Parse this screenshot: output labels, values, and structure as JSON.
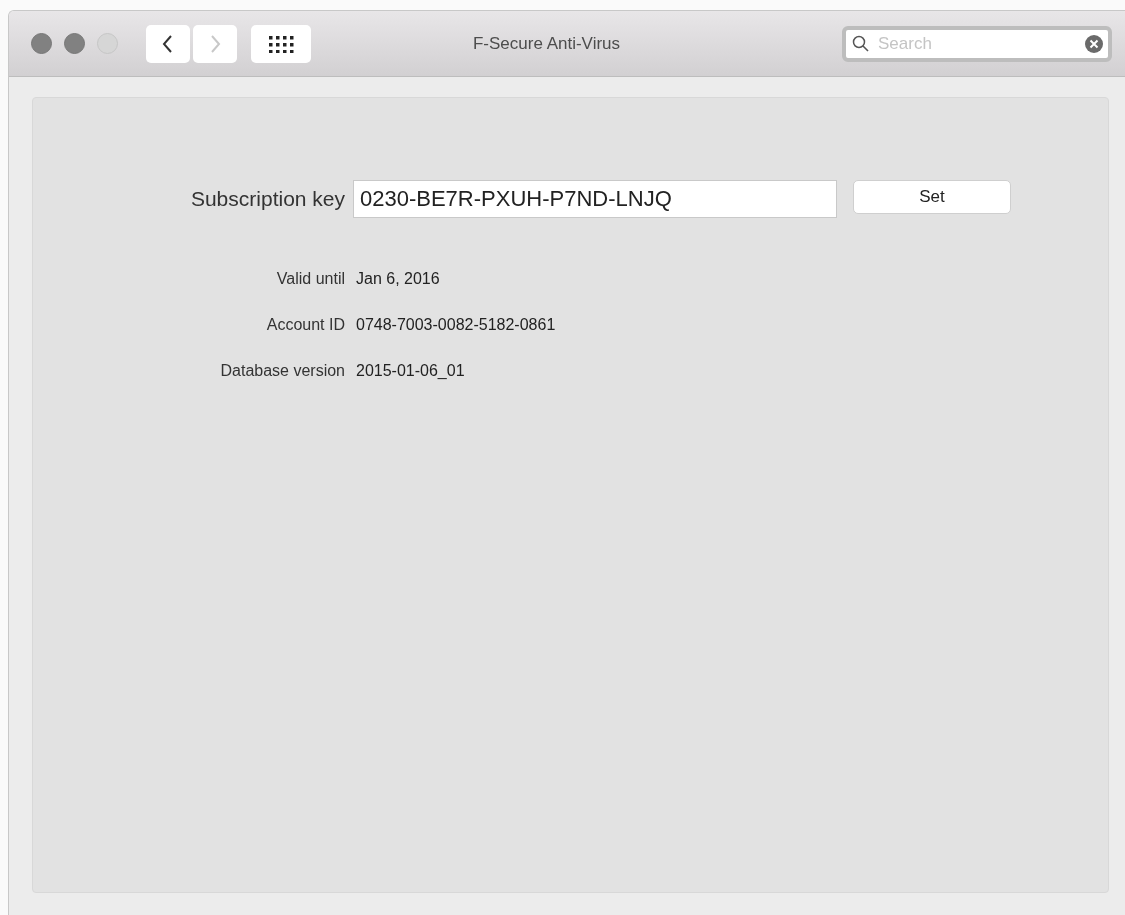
{
  "window": {
    "title": "F-Secure Anti-Virus",
    "traffic_lights": [
      {
        "disabled": false
      },
      {
        "disabled": false
      },
      {
        "disabled": true
      }
    ],
    "nav": [
      {
        "kind": "back",
        "disabled": false
      },
      {
        "kind": "forward",
        "disabled": true
      }
    ],
    "search": {
      "placeholder": "Search",
      "focused": true
    }
  },
  "subscription": {
    "label": "Subscription key",
    "value": "0230-BE7R-PXUH-P7ND-LNJQ",
    "button": "Set"
  },
  "info": [
    {
      "label": "Valid until",
      "value": "Jan 6, 2016"
    },
    {
      "label": "Account ID",
      "value": "0748-7003-0082-5182-0861"
    },
    {
      "label": "Database version",
      "value": "2015-01-06_01"
    }
  ]
}
